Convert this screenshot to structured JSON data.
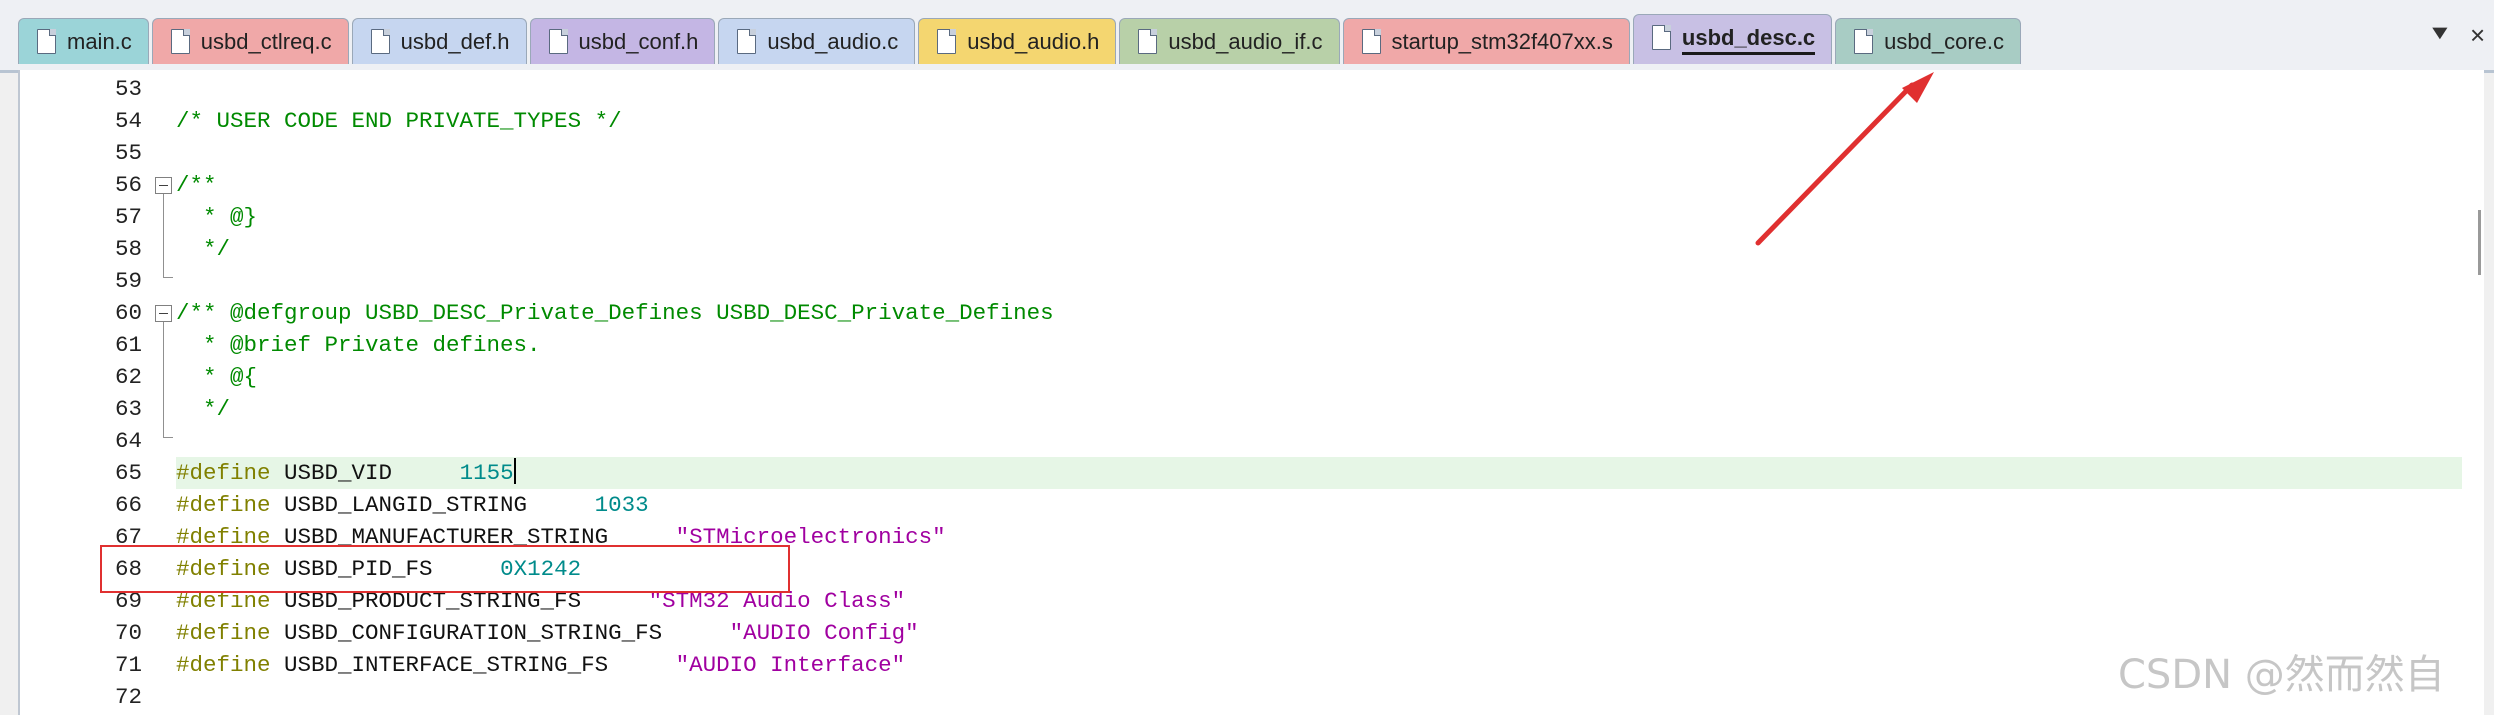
{
  "tabs": [
    {
      "label": "main.c",
      "color": "#9bd4d8"
    },
    {
      "label": "usbd_ctlreq.c",
      "color": "#f0a8a8"
    },
    {
      "label": "usbd_def.h",
      "color": "#c6d6f0"
    },
    {
      "label": "usbd_conf.h",
      "color": "#c4b6e4"
    },
    {
      "label": "usbd_audio.c",
      "color": "#c6d6f0"
    },
    {
      "label": "usbd_audio.h",
      "color": "#f4d670"
    },
    {
      "label": "usbd_audio_if.c",
      "color": "#b8d0a8"
    },
    {
      "label": "startup_stm32f407xx.s",
      "color": "#f0a8a8"
    },
    {
      "label": "usbd_desc.c",
      "color": "#c8c0e4",
      "active": true
    },
    {
      "label": "usbd_core.c",
      "color": "#a8ccc4"
    }
  ],
  "tab_menu_symbol": "▼",
  "tab_close_symbol": "×",
  "lines": [
    {
      "num": "53",
      "code": ""
    },
    {
      "num": "54",
      "code": "/* USER CODE END PRIVATE_TYPES */"
    },
    {
      "num": "55",
      "code": ""
    },
    {
      "num": "56",
      "code": "/**"
    },
    {
      "num": "57",
      "code": "  * @}"
    },
    {
      "num": "58",
      "code": "  */"
    },
    {
      "num": "59",
      "code": ""
    },
    {
      "num": "60",
      "code": "/** @defgroup USBD_DESC_Private_Defines USBD_DESC_Private_Defines"
    },
    {
      "num": "61",
      "code": "  * @brief Private defines."
    },
    {
      "num": "62",
      "code": "  * @{"
    },
    {
      "num": "63",
      "code": "  */"
    },
    {
      "num": "64",
      "code": ""
    },
    {
      "num": "65",
      "keyword": "#define",
      "name": " USBD_VID",
      "pad": "     ",
      "value": "1155",
      "vtype": "n",
      "current": true
    },
    {
      "num": "66",
      "keyword": "#define",
      "name": " USBD_LANGID_STRING",
      "pad": "     ",
      "value": "1033",
      "vtype": "n"
    },
    {
      "num": "67",
      "keyword": "#define",
      "name": " USBD_MANUFACTURER_STRING",
      "pad": "     ",
      "value": "\"STMicroelectronics\"",
      "vtype": "s"
    },
    {
      "num": "68",
      "keyword": "#define",
      "name": " USBD_PID_FS",
      "pad": "     ",
      "value": "0X1242",
      "vtype": "n"
    },
    {
      "num": "69",
      "keyword": "#define",
      "name": " USBD_PRODUCT_STRING_FS",
      "pad": "     ",
      "value": "\"STM32 Audio Class\"",
      "vtype": "s"
    },
    {
      "num": "70",
      "keyword": "#define",
      "name": " USBD_CONFIGURATION_STRING_FS",
      "pad": "     ",
      "value": "\"AUDIO Config\"",
      "vtype": "s"
    },
    {
      "num": "71",
      "keyword": "#define",
      "name": " USBD_INTERFACE_STRING_FS",
      "pad": "     ",
      "value": "\"AUDIO Interface\"",
      "vtype": "s"
    },
    {
      "num": "72",
      "code": ""
    }
  ],
  "watermark": "CSDN @然而然自",
  "colors": {
    "comment": "#008a00",
    "keyword": "#808000",
    "number": "#008b8b",
    "string": "#a000a0",
    "current_line": "#e6f6e6",
    "annotation": "#e03030"
  }
}
